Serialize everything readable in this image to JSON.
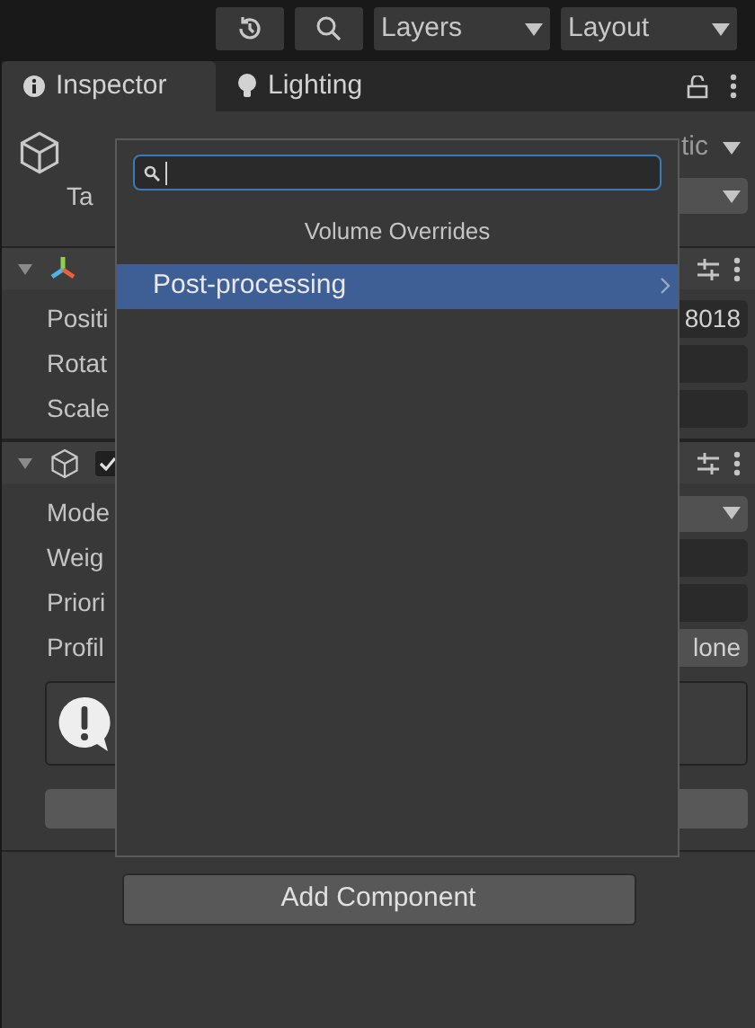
{
  "toolbar": {
    "layers": "Layers",
    "layout": "Layout"
  },
  "tabs": [
    {
      "label": "Inspector",
      "selected": true
    },
    {
      "label": "Lighting",
      "selected": false
    }
  ],
  "object_header": {
    "static_label": "tic",
    "tag_label": "Ta"
  },
  "components": [
    {
      "kind": "transform",
      "expanded": true,
      "rows": [
        {
          "label": "Positi",
          "kind": "field",
          "value": "8018"
        },
        {
          "label": "Rotat",
          "kind": "field"
        },
        {
          "label": "Scale",
          "kind": "field"
        }
      ]
    },
    {
      "kind": "volume",
      "expanded": true,
      "enabled": true,
      "rows": [
        {
          "label": "Mode",
          "kind": "dropdown"
        },
        {
          "label": "Weig",
          "kind": "field"
        },
        {
          "label": "Priori",
          "kind": "field"
        },
        {
          "label": "Profil",
          "kind": "object",
          "value": "lone"
        }
      ]
    }
  ],
  "add_component": "Add Component",
  "popup": {
    "title": "Volume Overrides",
    "items": [
      {
        "label": "Post-processing",
        "selected": true,
        "has_submenu": true
      }
    ]
  }
}
